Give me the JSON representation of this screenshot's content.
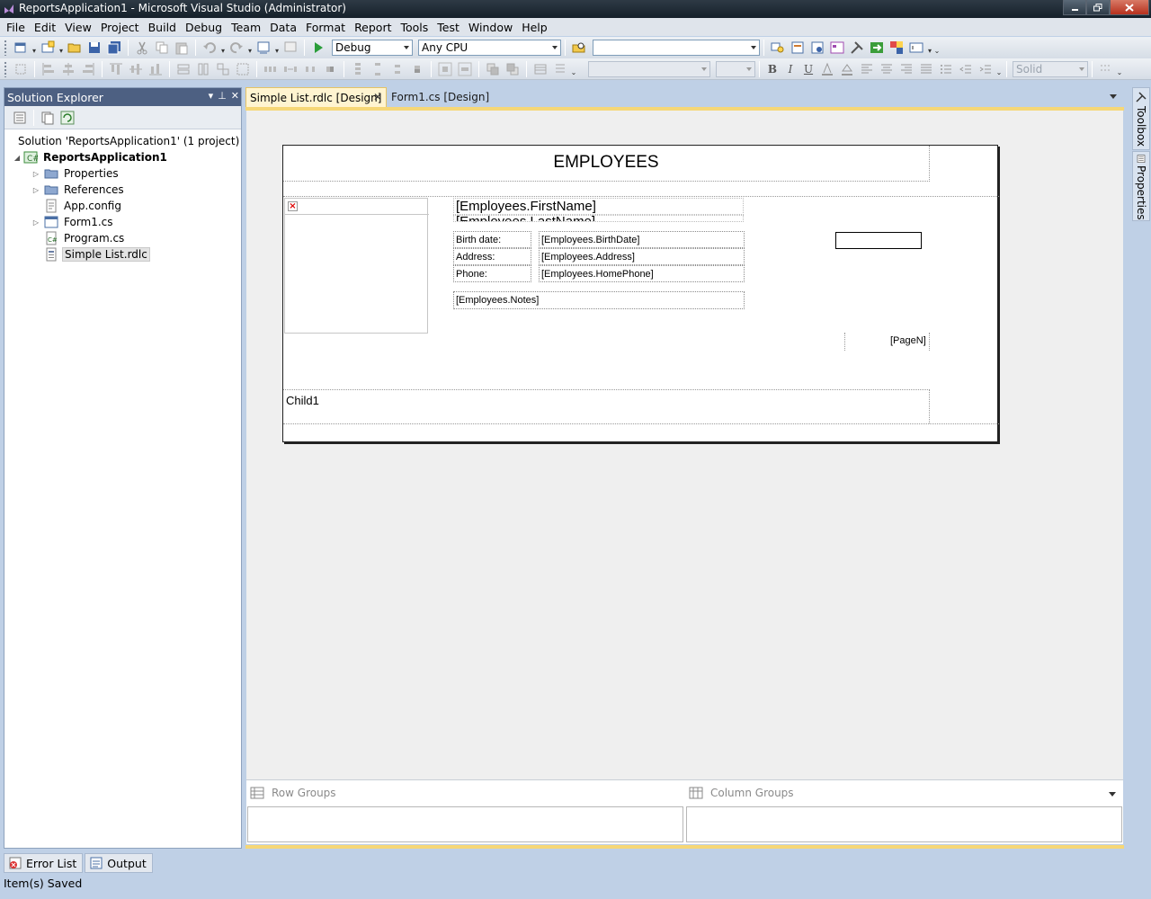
{
  "window": {
    "title": "ReportsApplication1 - Microsoft Visual Studio (Administrator)",
    "controls": [
      "minimize",
      "maximize",
      "close"
    ]
  },
  "menu": [
    "File",
    "Edit",
    "View",
    "Project",
    "Build",
    "Debug",
    "Team",
    "Data",
    "Format",
    "Report",
    "Tools",
    "Test",
    "Window",
    "Help"
  ],
  "toolbar": {
    "configuration": "Debug",
    "platform": "Any CPU",
    "find_value": "",
    "line_style": "Solid",
    "font_name": "",
    "font_size": ""
  },
  "solution_explorer": {
    "title": "Solution Explorer",
    "items": [
      {
        "label": "Solution 'ReportsApplication1' (1 project)",
        "icon": "solution-icon",
        "level": 0
      },
      {
        "label": "ReportsApplication1",
        "icon": "csharp-project-icon",
        "level": 1,
        "expanded": true
      },
      {
        "label": "Properties",
        "icon": "folder-icon",
        "level": 2,
        "expandable": true
      },
      {
        "label": "References",
        "icon": "folder-icon",
        "level": 2,
        "expandable": true
      },
      {
        "label": "App.config",
        "icon": "config-file-icon",
        "level": 2
      },
      {
        "label": "Form1.cs",
        "icon": "form-icon",
        "level": 2,
        "expandable": true
      },
      {
        "label": "Program.cs",
        "icon": "cs-file-icon",
        "level": 2
      },
      {
        "label": "Simple List.rdlc",
        "icon": "report-file-icon",
        "level": 2,
        "selected": true
      }
    ]
  },
  "tabs": [
    {
      "label": "Simple List.rdlc [Design]",
      "active": true
    },
    {
      "label": "Form1.cs [Design]",
      "active": false
    }
  ],
  "report": {
    "title": "EMPLOYEES",
    "first_name": "[Employees.FirstName]",
    "last_name": "[Employees.LastName]",
    "labels": {
      "birth_date": "Birth date:",
      "address": "Address:",
      "phone": "Phone:"
    },
    "fields": {
      "birth_date": "[Employees.BirthDate]",
      "address": "[Employees.Address]",
      "phone": "[Employees.HomePhone]",
      "notes": "[Employees.Notes]"
    },
    "page_number": "[PageN]",
    "child_group": "Child1"
  },
  "grouping": {
    "row_groups": "Row Groups",
    "column_groups": "Column Groups"
  },
  "side_tabs": [
    "Toolbox",
    "Properties"
  ],
  "bottom_tabs": [
    "Error List",
    "Output"
  ],
  "status": "Item(s) Saved"
}
